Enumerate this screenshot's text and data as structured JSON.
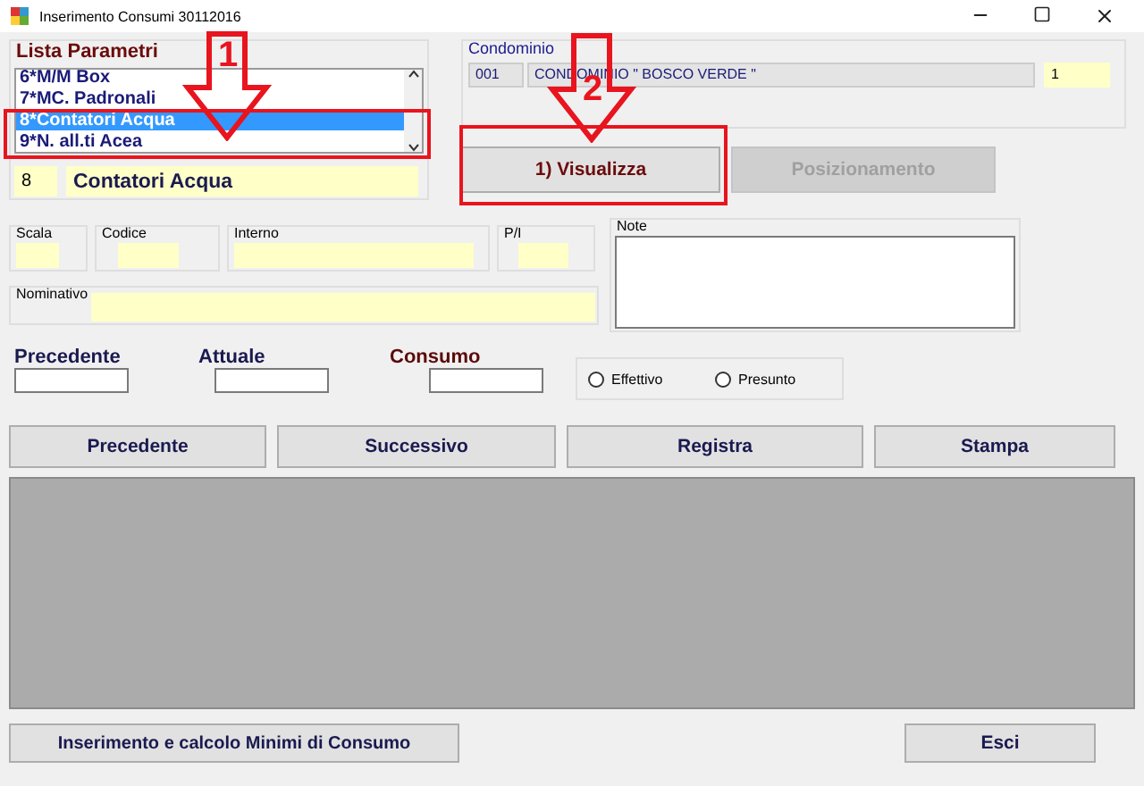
{
  "window": {
    "title": "Inserimento Consumi 30112016"
  },
  "parameter_list": {
    "label": "Lista Parametri",
    "items": [
      {
        "text": "6*M/M Box",
        "selected": false
      },
      {
        "text": "7*MC. Padronali",
        "selected": false
      },
      {
        "text": "8*Contatori Acqua",
        "selected": true
      },
      {
        "text": "9*N. all.ti Acea",
        "selected": false
      }
    ],
    "code": "8",
    "name": "Contatori Acqua"
  },
  "condominium": {
    "label": "Condominio",
    "code": "001",
    "name": "CONDOMINIO \" BOSCO VERDE \"",
    "number": "1"
  },
  "actions": [
    {
      "label": "1) Visualizza",
      "disabled": false
    },
    {
      "label": "Posizionamento",
      "disabled": true
    }
  ],
  "fields": [
    {
      "label": "Scala"
    },
    {
      "label": "Codice"
    },
    {
      "label": "Interno"
    },
    {
      "label": "P/I"
    }
  ],
  "nominativo": {
    "label": "Nominativo"
  },
  "note": {
    "label": "Note"
  },
  "readings": [
    {
      "label": "Precedente",
      "kind": "input"
    },
    {
      "label": "Attuale",
      "kind": "input"
    },
    {
      "label": "Consumo",
      "kind": "result"
    }
  ],
  "reading_type": [
    {
      "label": "Effettivo",
      "selected": false
    },
    {
      "label": "Presunto",
      "selected": false
    }
  ],
  "nav_buttons": [
    "Precedente",
    "Successivo",
    "Registra",
    "Stampa"
  ],
  "bottom_buttons": [
    "Inserimento e calcolo Minimi di Consumo",
    "Esci"
  ],
  "annotations": [
    {
      "number": "1"
    },
    {
      "number": "2"
    }
  ]
}
